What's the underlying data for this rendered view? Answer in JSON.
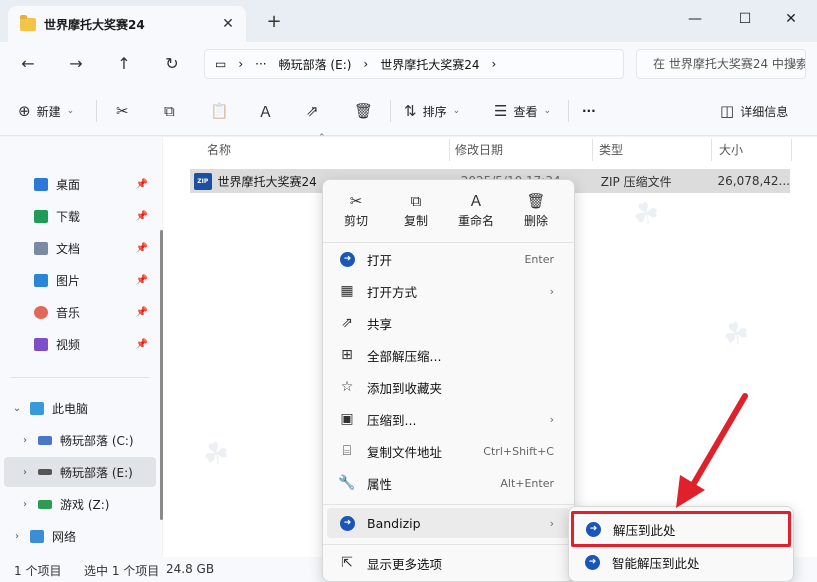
{
  "window": {
    "tab_title": "世界摩托大奖赛24",
    "tab_close": "✕",
    "new_tab": "+",
    "minimize": "—",
    "maximize": "☐",
    "close": "✕"
  },
  "nav": {
    "back": "←",
    "forward": "→",
    "up": "↑",
    "refresh": "↻"
  },
  "address": {
    "computer_icon": "▭",
    "sep": "›",
    "ellipsis": "···",
    "crumb1": "畅玩部落 (E:)",
    "crumb2": "世界摩托大奖赛24",
    "search_placeholder": "在 世界摩托大奖赛24 中搜索"
  },
  "toolbar": {
    "new_label": "新建",
    "sort_label": "排序",
    "view_label": "查看",
    "more": "···",
    "details_label": "详细信息"
  },
  "sidebar": {
    "quick": [
      {
        "label": "桌面",
        "color": "#2b79d8"
      },
      {
        "label": "下载",
        "color": "#1f9d55"
      },
      {
        "label": "文档",
        "color": "#7a8aa0"
      },
      {
        "label": "图片",
        "color": "#2a86d6"
      },
      {
        "label": "音乐",
        "color": "#e2685a"
      },
      {
        "label": "视频",
        "color": "#7b4fc9"
      }
    ],
    "this_pc": "此电脑",
    "drives": [
      "畅玩部落 (C:)",
      "畅玩部落 (E:)",
      "游戏 (Z:)"
    ],
    "network": "网络"
  },
  "columns": {
    "name": "名称",
    "date": "修改日期",
    "type": "类型",
    "size": "大小"
  },
  "file": {
    "icon_text": "ZIP",
    "name": "世界摩托大奖赛24",
    "date": "2025/5/10 17:34",
    "type": "ZIP 压缩文件",
    "size": "26,078,42..."
  },
  "status": {
    "count": "1 个项目",
    "selected": "选中 1 个项目",
    "size": "24.8 GB"
  },
  "context_menu": {
    "top": [
      {
        "label": "剪切",
        "icon": "✂"
      },
      {
        "label": "复制",
        "icon": "⧉"
      },
      {
        "label": "重命名",
        "icon": "Ａ"
      },
      {
        "label": "删除",
        "icon": "🗑"
      }
    ],
    "items": [
      {
        "label": "打开",
        "shortcut": "Enter",
        "icon": "bandizip"
      },
      {
        "label": "打开方式",
        "shortcut": "",
        "icon": "apps",
        "arrow": "›"
      },
      {
        "label": "共享",
        "shortcut": "",
        "icon": "share"
      },
      {
        "label": "全部解压缩...",
        "shortcut": "",
        "icon": "extract"
      },
      {
        "label": "添加到收藏夹",
        "shortcut": "",
        "icon": "star"
      },
      {
        "label": "压缩到...",
        "shortcut": "",
        "icon": "compress",
        "arrow": "›"
      },
      {
        "label": "复制文件地址",
        "shortcut": "Ctrl+Shift+C",
        "icon": "path"
      },
      {
        "label": "属性",
        "shortcut": "Alt+Enter",
        "icon": "wrench"
      },
      {
        "label": "Bandizip",
        "shortcut": "",
        "icon": "bandizip",
        "arrow": "›"
      },
      {
        "label": "显示更多选项",
        "shortcut": "",
        "icon": "more"
      }
    ]
  },
  "submenu": {
    "items": [
      "解压到此处",
      "智能解压到此处"
    ]
  },
  "colors": {
    "highlight": "#e0202a",
    "bandizip": "#1a55b8"
  }
}
